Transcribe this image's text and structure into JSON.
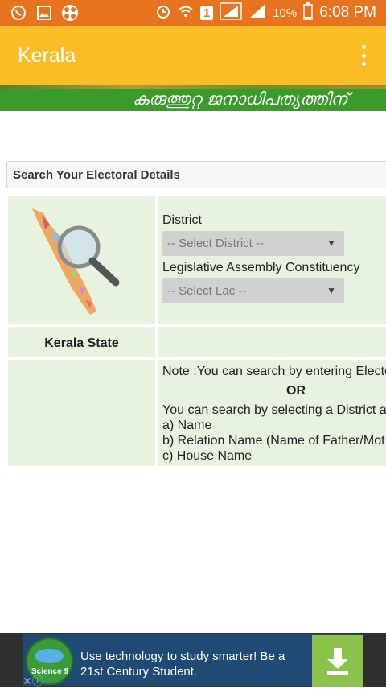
{
  "status_bar": {
    "battery": "10%",
    "time": "6:08 PM",
    "sim_badge": "1"
  },
  "app_bar": {
    "title": "Kerala"
  },
  "banner": {
    "text": "കരുത്തുറ്റ ജനാധിപത്യത്തിന്"
  },
  "search_section": {
    "heading": "Search Your Electoral Details"
  },
  "form": {
    "district_label": "District",
    "district_select": "-- Select District --",
    "lac_label": "Legislative Assembly Constituency",
    "lac_select": "-- Select Lac --"
  },
  "map_caption": "Kerala State",
  "notes": {
    "line1": "Note :You can search by entering Electo",
    "or": "OR",
    "line2": "You can search by selecting a District a",
    "item_a": "a) Name",
    "item_b": "b) Relation Name (Name of Father/Mot",
    "item_c": "c) House Name"
  },
  "ad": {
    "line1": "Use technology to study smarter! Be a",
    "line2": "21st Century Student.",
    "logo_text": "Science 9"
  },
  "colors": {
    "status_bar": "#e8731f",
    "app_bar": "#fbbd26",
    "banner": "#3a9a2a",
    "table_cell": "#e7f3df",
    "ad_button": "#8bc34a"
  }
}
